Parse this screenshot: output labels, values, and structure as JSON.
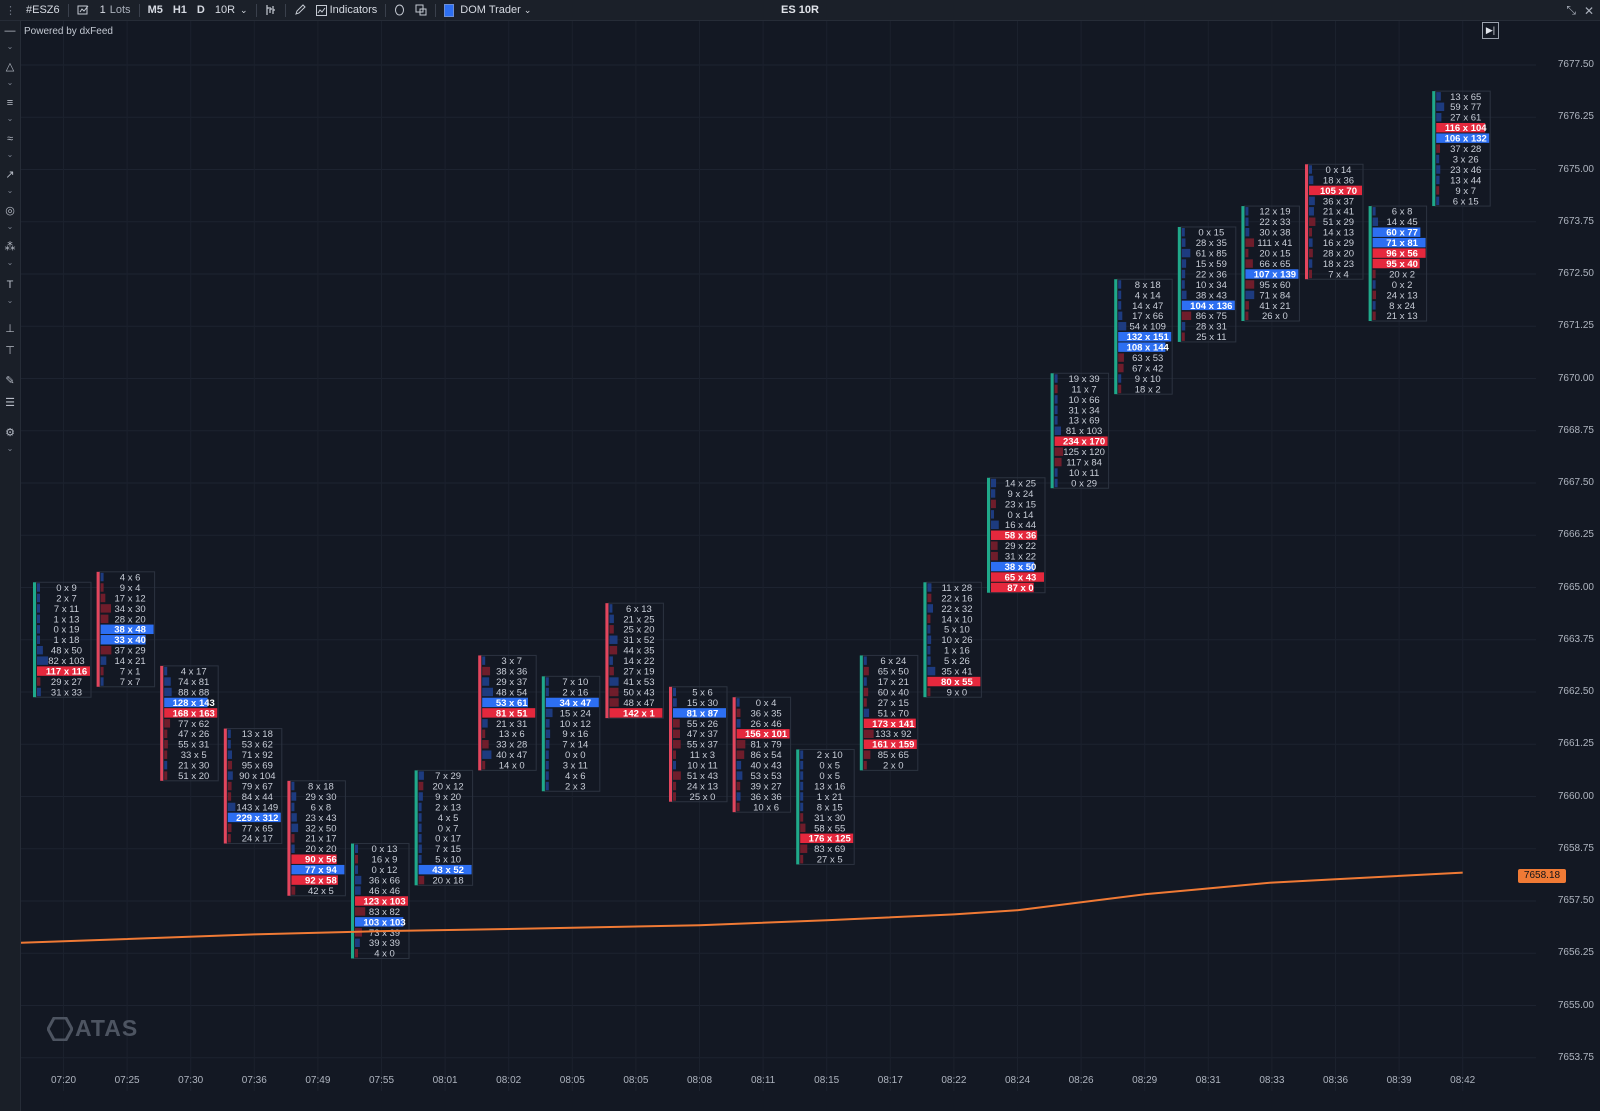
{
  "toolbar": {
    "symbol": "#ESZ6",
    "lots_value": "1",
    "lots_unit": "Lots",
    "tf_m5": "M5",
    "tf_h1": "H1",
    "tf_d": "D",
    "tf_range": "10R",
    "indicators": "Indicators",
    "dom_trader": "DOM Trader",
    "chart_title": "ES 10R"
  },
  "chart": {
    "powered_by": "Powered by dxFeed",
    "current_price": "7658.18",
    "logo": "ATAS",
    "colors": {
      "bid": "#e5283d",
      "ask": "#2d6ff2",
      "bull": "#1fa98a",
      "bear": "#e3455d",
      "ma": "#f07a35",
      "bg": "#131823"
    }
  },
  "price_labels": [
    "7677.50",
    "7676.25",
    "7675.00",
    "7673.75",
    "7672.50",
    "7671.25",
    "7670.00",
    "7668.75",
    "7667.50",
    "7666.25",
    "7665.00",
    "7663.75",
    "7662.50",
    "7661.25",
    "7660.00",
    "7658.75",
    "7657.50",
    "7656.25",
    "7655.00",
    "7653.75"
  ],
  "time_labels": [
    "07:20",
    "07:25",
    "07:30",
    "07:36",
    "07:49",
    "07:55",
    "08:01",
    "08:02",
    "08:05",
    "08:05",
    "08:08",
    "08:11",
    "08:15",
    "08:17",
    "08:22",
    "08:24",
    "08:26",
    "08:29",
    "08:31",
    "08:33",
    "08:36",
    "08:39",
    "08:42"
  ],
  "chart_data": {
    "type": "footprint",
    "price_tick": 0.25,
    "ylim": [
      7653.5,
      7678.0
    ],
    "bars": [
      {
        "time": "07:20",
        "top": 7665.0,
        "bull": true,
        "cells": [
          "0 x 9",
          "2 x 7",
          "7 x 11",
          "1 x 13",
          "0 x 19",
          "1 x 18",
          "48 x 50",
          "82 x 103",
          "117 x 116",
          "29 x 27",
          "31 x 33"
        ]
      },
      {
        "time": "07:25",
        "top": 7665.25,
        "bull": false,
        "cells": [
          "4 x 6",
          "9 x 4",
          "17 x 12",
          "34 x 30",
          "28 x 20",
          "38 x 48",
          "33 x 40",
          "37 x 29",
          "14 x 21",
          "7 x 1",
          "7 x 7"
        ]
      },
      {
        "time": "07:30",
        "top": 7663.0,
        "bull": false,
        "cells": [
          "4 x 17",
          "74 x 81",
          "88 x 88",
          "128 x 143",
          "168 x 163",
          "77 x 62",
          "47 x 26",
          "55 x 31",
          "33 x 5",
          "21 x 30",
          "51 x 20"
        ]
      },
      {
        "time": "07:36",
        "top": 7661.5,
        "bull": false,
        "cells": [
          "13 x 18",
          "53 x 62",
          "71 x 92",
          "95 x 69",
          "90 x 104",
          "79 x 67",
          "84 x 44",
          "143 x 149",
          "229 x 312",
          "77 x 65",
          "24 x 17"
        ]
      },
      {
        "time": "07:49",
        "top": 7660.25,
        "bull": false,
        "cells": [
          "8 x 18",
          "29 x 30",
          "6 x 8",
          "23 x 43",
          "32 x 50",
          "21 x 17",
          "20 x 20",
          "90 x 56",
          "77 x 94",
          "92 x 58",
          "42 x 5"
        ]
      },
      {
        "time": "07:55",
        "top": 7658.75,
        "bull": true,
        "cells": [
          "0 x 13",
          "16 x 9",
          "0 x 12",
          "36 x 66",
          "46 x 46",
          "123 x 103",
          "83 x 82",
          "103 x 103",
          "73 x 39",
          "39 x 39",
          "4 x 0"
        ]
      },
      {
        "time": "08:01",
        "top": 7660.5,
        "bull": true,
        "cells": [
          "7 x 29",
          "20 x 12",
          "9 x 20",
          "2 x 13",
          "4 x 5",
          "0 x 7",
          "0 x 17",
          "7 x 15",
          "5 x 10",
          "43 x 52",
          "20 x 18"
        ]
      },
      {
        "time": "08:02",
        "top": 7663.25,
        "bull": false,
        "cells": [
          "3 x 7",
          "38 x 36",
          "29 x 37",
          "48 x 54",
          "53 x 61",
          "81 x 51",
          "21 x 31",
          "13 x 6",
          "33 x 28",
          "40 x 47",
          "14 x 0"
        ]
      },
      {
        "time": "08:05",
        "top": 7662.75,
        "bull": true,
        "cells": [
          "7 x 10",
          "2 x 16",
          "34 x 47",
          "15 x 24",
          "10 x 12",
          "9 x 16",
          "7 x 14",
          "0 x 0",
          "3 x 11",
          "4 x 6",
          "2 x 3"
        ]
      },
      {
        "time": "08:05",
        "top": 7664.5,
        "bull": false,
        "cells": [
          "6 x 13",
          "21 x 25",
          "25 x 20",
          "31 x 52",
          "44 x 35",
          "14 x 22",
          "27 x 19",
          "41 x 53",
          "50 x 43",
          "48 x 47",
          "142 x 1"
        ]
      },
      {
        "time": "08:08",
        "top": 7662.5,
        "bull": false,
        "cells": [
          "5 x 6",
          "15 x 30",
          "81 x 87",
          "55 x 26",
          "47 x 37",
          "55 x 37",
          "11 x 3",
          "10 x 11",
          "51 x 43",
          "24 x 13",
          "25 x 0"
        ]
      },
      {
        "time": "08:11",
        "top": 7662.25,
        "bull": false,
        "cells": [
          "0 x 4",
          "36 x 35",
          "26 x 46",
          "156 x 101",
          "81 x 79",
          "86 x 54",
          "40 x 43",
          "53 x 53",
          "39 x 27",
          "36 x 36",
          "10 x 6"
        ]
      },
      {
        "time": "08:15",
        "top": 7661.0,
        "bull": true,
        "cells": [
          "2 x 10",
          "0 x 5",
          "0 x 5",
          "13 x 16",
          "1 x 21",
          "8 x 15",
          "31 x 30",
          "58 x 55",
          "176 x 125",
          "83 x 69",
          "27 x 5"
        ]
      },
      {
        "time": "08:17",
        "top": 7663.25,
        "bull": true,
        "cells": [
          "6 x 24",
          "65 x 50",
          "17 x 21",
          "60 x 40",
          "27 x 15",
          "51 x 70",
          "173 x 141",
          "133 x 92",
          "161 x 159",
          "85 x 65",
          "2 x 0"
        ]
      },
      {
        "time": "08:22",
        "top": 7665.0,
        "bull": true,
        "cells": [
          "11 x 28",
          "22 x 16",
          "22 x 32",
          "14 x 10",
          "5 x 10",
          "10 x 26",
          "1 x 16",
          "5 x 26",
          "35 x 41",
          "80 x 55",
          "9 x 0"
        ]
      },
      {
        "time": "08:24",
        "top": 7667.5,
        "bull": true,
        "cells": [
          "14 x 25",
          "9 x 24",
          "23 x 15",
          "0 x 14",
          "16 x 44",
          "58 x 36",
          "29 x 22",
          "31 x 22",
          "38 x 50",
          "65 x 43",
          "87 x 0"
        ]
      },
      {
        "time": "08:26",
        "top": 7670.0,
        "bull": true,
        "cells": [
          "19 x 39",
          "11 x 7",
          "10 x 66",
          "31 x 34",
          "13 x 69",
          "81 x 103",
          "234 x 170",
          "125 x 120",
          "117 x 84",
          "10 x 11",
          "0 x 29"
        ]
      },
      {
        "time": "08:29",
        "top": 7672.25,
        "bull": true,
        "cells": [
          "8 x 18",
          "4 x 14",
          "14 x 47",
          "17 x 66",
          "54 x 109",
          "132 x 151",
          "108 x 144",
          "63 x 53",
          "67 x 42",
          "9 x 10",
          "18 x 2"
        ]
      },
      {
        "time": "08:31",
        "top": 7673.5,
        "bull": true,
        "cells": [
          "0 x 15",
          "28 x 35",
          "61 x 85",
          "15 x 59",
          "22 x 36",
          "10 x 34",
          "38 x 43",
          "104 x 136",
          "86 x 75",
          "28 x 31",
          "25 x 11"
        ]
      },
      {
        "time": "08:33",
        "top": 7674.0,
        "bull": true,
        "cells": [
          "12 x 19",
          "22 x 33",
          "30 x 38",
          "111 x 41",
          "20 x 15",
          "66 x 65",
          "107 x 139",
          "95 x 60",
          "71 x 84",
          "41 x 21",
          "26 x 0"
        ]
      },
      {
        "time": "08:36",
        "top": 7675.0,
        "bull": false,
        "cells": [
          "0 x 14",
          "18 x 36",
          "105 x 70",
          "36 x 37",
          "21 x 41",
          "51 x 29",
          "14 x 13",
          "16 x 29",
          "28 x 20",
          "18 x 23",
          "7 x 4"
        ]
      },
      {
        "time": "08:39",
        "top": 7674.0,
        "bull": true,
        "cells": [
          "6 x 8",
          "14 x 45",
          "60 x 77",
          "71 x 81",
          "96 x 56",
          "95 x 40",
          "20 x 2",
          "0 x 2",
          "24 x 13",
          "8 x 24",
          "21 x 13"
        ]
      },
      {
        "time": "08:42",
        "top": 7676.75,
        "bull": true,
        "cells": [
          "13 x 65",
          "59 x 77",
          "27 x 61",
          "116 x 104",
          "106 x 132",
          "37 x 28",
          "3 x 26",
          "23 x 46",
          "13 x 44",
          "9 x 7",
          "6 x 15"
        ]
      }
    ],
    "ma_line": [
      {
        "time": "07:20",
        "value": 7656.5
      },
      {
        "time": "07:36",
        "value": 7656.7
      },
      {
        "time": "07:55",
        "value": 7656.78
      },
      {
        "time": "08:02",
        "value": 7656.83
      },
      {
        "time": "08:08",
        "value": 7656.92
      },
      {
        "time": "08:15",
        "value": 7657.04
      },
      {
        "time": "08:22",
        "value": 7657.18
      },
      {
        "time": "08:24",
        "value": 7657.28
      },
      {
        "time": "08:29",
        "value": 7657.66
      },
      {
        "time": "08:33",
        "value": 7657.94
      },
      {
        "time": "08:36",
        "value": 7658.02
      },
      {
        "time": "08:42",
        "value": 7658.18
      }
    ]
  }
}
